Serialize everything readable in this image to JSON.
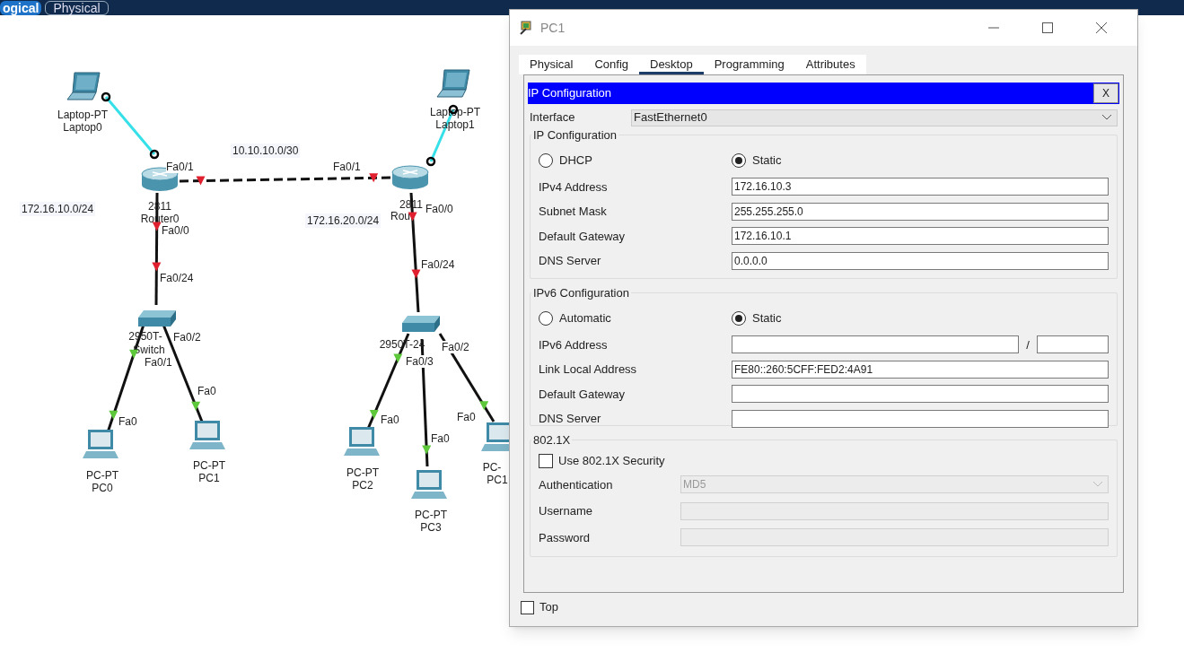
{
  "top_bar": {
    "tabs": [
      {
        "label": "ogical",
        "selected": true
      },
      {
        "label": "Physical",
        "selected": false
      }
    ]
  },
  "topology": {
    "nodes": [
      {
        "kind": "laptop",
        "labels": [
          "Laptop-PT",
          "Laptop0"
        ]
      },
      {
        "kind": "laptop",
        "labels": [
          "Laptop-PT",
          "Laptop1"
        ]
      },
      {
        "kind": "router",
        "labels": [
          "2811",
          "Router0"
        ]
      },
      {
        "kind": "router",
        "labels": [
          "2811",
          "Rou"
        ]
      },
      {
        "kind": "switch",
        "labels": [
          "2950T-",
          "Switch"
        ]
      },
      {
        "kind": "switch",
        "labels": [
          "2950T-24"
        ]
      },
      {
        "kind": "pc",
        "labels": [
          "PC-PT",
          "PC0"
        ]
      },
      {
        "kind": "pc",
        "labels": [
          "PC-PT",
          "PC1"
        ]
      },
      {
        "kind": "pc",
        "labels": [
          "PC-PT",
          "PC2"
        ]
      },
      {
        "kind": "pc",
        "labels": [
          "PC-PT",
          "PC3"
        ]
      },
      {
        "kind": "pc",
        "labels": [
          "PC-",
          "PC1"
        ]
      }
    ],
    "links": [
      {
        "kind": "console",
        "ends": [
          {
            "kind": "start",
            "color": "#000000"
          },
          {
            "kind": "end",
            "color": "#000000"
          }
        ]
      },
      {
        "kind": "console",
        "ends": [
          {
            "kind": "start",
            "color": "#000000"
          },
          {
            "kind": "end",
            "color": "#000000"
          }
        ]
      },
      {
        "kind": "crossover",
        "ends": [
          {
            "kind": "start",
            "color": "#e0202e"
          },
          {
            "kind": "end",
            "color": "#e0202e"
          }
        ]
      },
      {
        "kind": "straight",
        "ends": [
          {
            "kind": "start",
            "color": "#e0202e"
          },
          {
            "kind": "end",
            "color": "#e0202e"
          }
        ]
      },
      {
        "kind": "straight",
        "ends": [
          {
            "kind": "start",
            "color": "#e0202e"
          },
          {
            "kind": "end",
            "color": "#e0202e"
          }
        ]
      },
      {
        "kind": "straight",
        "ends": [
          {
            "kind": "start",
            "color": "#5cc83a"
          },
          {
            "kind": "end",
            "color": "#5cc83a"
          }
        ]
      },
      {
        "kind": "straight",
        "ends": [
          {
            "kind": "end",
            "color": "#5cc83a"
          }
        ]
      },
      {
        "kind": "straight",
        "ends": [
          {
            "kind": "start",
            "color": "#5cc83a"
          },
          {
            "kind": "end",
            "color": "#5cc83a"
          }
        ]
      },
      {
        "kind": "straight",
        "ends": [
          {
            "kind": "end",
            "color": "#5cc83a"
          }
        ]
      },
      {
        "kind": "straight",
        "ends": [
          {
            "kind": "end",
            "color": "#5cc83a"
          }
        ]
      }
    ],
    "network_labels": [
      "10.10.10.0/30",
      "172.16.10.0/24",
      "172.16.20.0/24"
    ],
    "port_labels": [
      "Fa0/1",
      "Fa0/1",
      "Fa0/0",
      "Fa0/0",
      "Fa0/24",
      "Fa0/24",
      "Fa0/2",
      "Fa0/1",
      "Fa0",
      "Fa0",
      "Fa0/2",
      "Fa0/3",
      "Fa0",
      "Fa0",
      "Fa0"
    ]
  },
  "dialog": {
    "title": "PC1",
    "tabs": [
      {
        "label": "Physical",
        "selected": false
      },
      {
        "label": "Config",
        "selected": false
      },
      {
        "label": "Desktop",
        "selected": true
      },
      {
        "label": "Programming",
        "selected": false
      },
      {
        "label": "Attributes",
        "selected": false
      }
    ],
    "panel": {
      "title": "IP Configuration",
      "close": "X"
    },
    "interface": {
      "label": "Interface",
      "value": "FastEthernet0"
    },
    "ipv4": {
      "legend": "IP Configuration",
      "modes": [
        {
          "label": "DHCP",
          "selected": false
        },
        {
          "label": "Static",
          "selected": true
        }
      ],
      "fields": [
        {
          "label": "IPv4 Address",
          "value": "172.16.10.3"
        },
        {
          "label": "Subnet Mask",
          "value": "255.255.255.0"
        },
        {
          "label": "Default Gateway",
          "value": "172.16.10.1"
        },
        {
          "label": "DNS Server",
          "value": "0.0.0.0"
        }
      ]
    },
    "ipv6": {
      "legend": "IPv6 Configuration",
      "modes": [
        {
          "label": "Automatic",
          "selected": false
        },
        {
          "label": "Static",
          "selected": true
        }
      ],
      "fields": [
        {
          "label": "IPv6 Address",
          "kind": "prefix",
          "separator": "/"
        },
        {
          "label": "Link Local Address",
          "value": "FE80::260:5CFF:FED2:4A91"
        },
        {
          "label": "Default Gateway"
        },
        {
          "label": "DNS Server"
        }
      ]
    },
    "dot1x": {
      "legend": "802.1X",
      "checkbox": {
        "label": "Use 802.1X Security",
        "checked": false
      },
      "fields": [
        {
          "label": "Authentication",
          "kind": "select",
          "value": "MD5",
          "disabled": true
        },
        {
          "label": "Username",
          "disabled": true
        },
        {
          "label": "Password",
          "disabled": true
        }
      ]
    },
    "top_checkbox": {
      "label": "Top",
      "checked": false
    }
  }
}
